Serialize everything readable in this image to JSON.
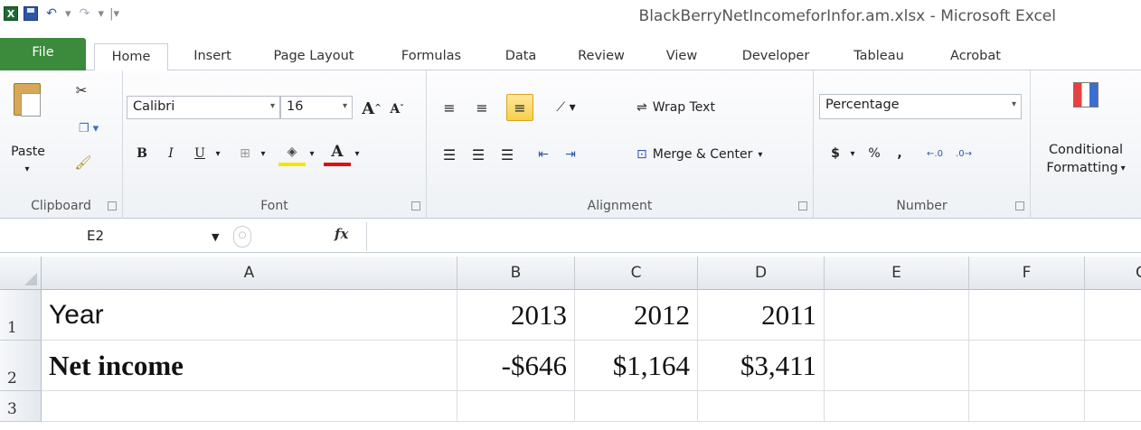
{
  "window": {
    "title": "BlackBerryNetIncomeforInfor.am.xlsx  -  Microsoft Excel"
  },
  "qat": {
    "excel_icon": "excel-logo-icon",
    "save_icon": "save-icon",
    "undo_icon": "undo-icon",
    "redo_icon": "redo-icon"
  },
  "tabs": [
    "File",
    "Home",
    "Insert",
    "Page Layout",
    "Formulas",
    "Data",
    "Review",
    "View",
    "Developer",
    "Tableau",
    "Acrobat"
  ],
  "active_tab": "Home",
  "ribbon": {
    "clipboard": {
      "label": "Clipboard",
      "paste": "Paste"
    },
    "font": {
      "label": "Font",
      "font_name": "Calibri",
      "font_size": "16",
      "bold": "B",
      "italic": "I",
      "underline": "U",
      "grow": "A",
      "shrink": "A",
      "font_color": "A"
    },
    "alignment": {
      "label": "Alignment",
      "wrap_text": "Wrap Text",
      "merge_center": "Merge & Center"
    },
    "number": {
      "label": "Number",
      "format": "Percentage",
      "currency": "$",
      "percent": "%",
      "comma": ","
    },
    "styles": {
      "conditional_line1": "Conditional",
      "conditional_line2": "Formatting"
    }
  },
  "formula_bar": {
    "name_box": "E2",
    "fx": "fx",
    "formula": ""
  },
  "grid": {
    "columns": [
      "A",
      "B",
      "C",
      "D",
      "E",
      "F",
      "G"
    ],
    "rows": [
      "1",
      "2",
      "3"
    ],
    "cells": {
      "A1": "Year",
      "B1": "2013",
      "C1": "2012",
      "D1": "2011",
      "A2": "Net income",
      "B2": "-$646",
      "C2": "$1,164",
      "D2": "$3,411"
    }
  },
  "colors": {
    "file_tab": "#3c8a3c",
    "selected_button": "#f7cf4b"
  }
}
